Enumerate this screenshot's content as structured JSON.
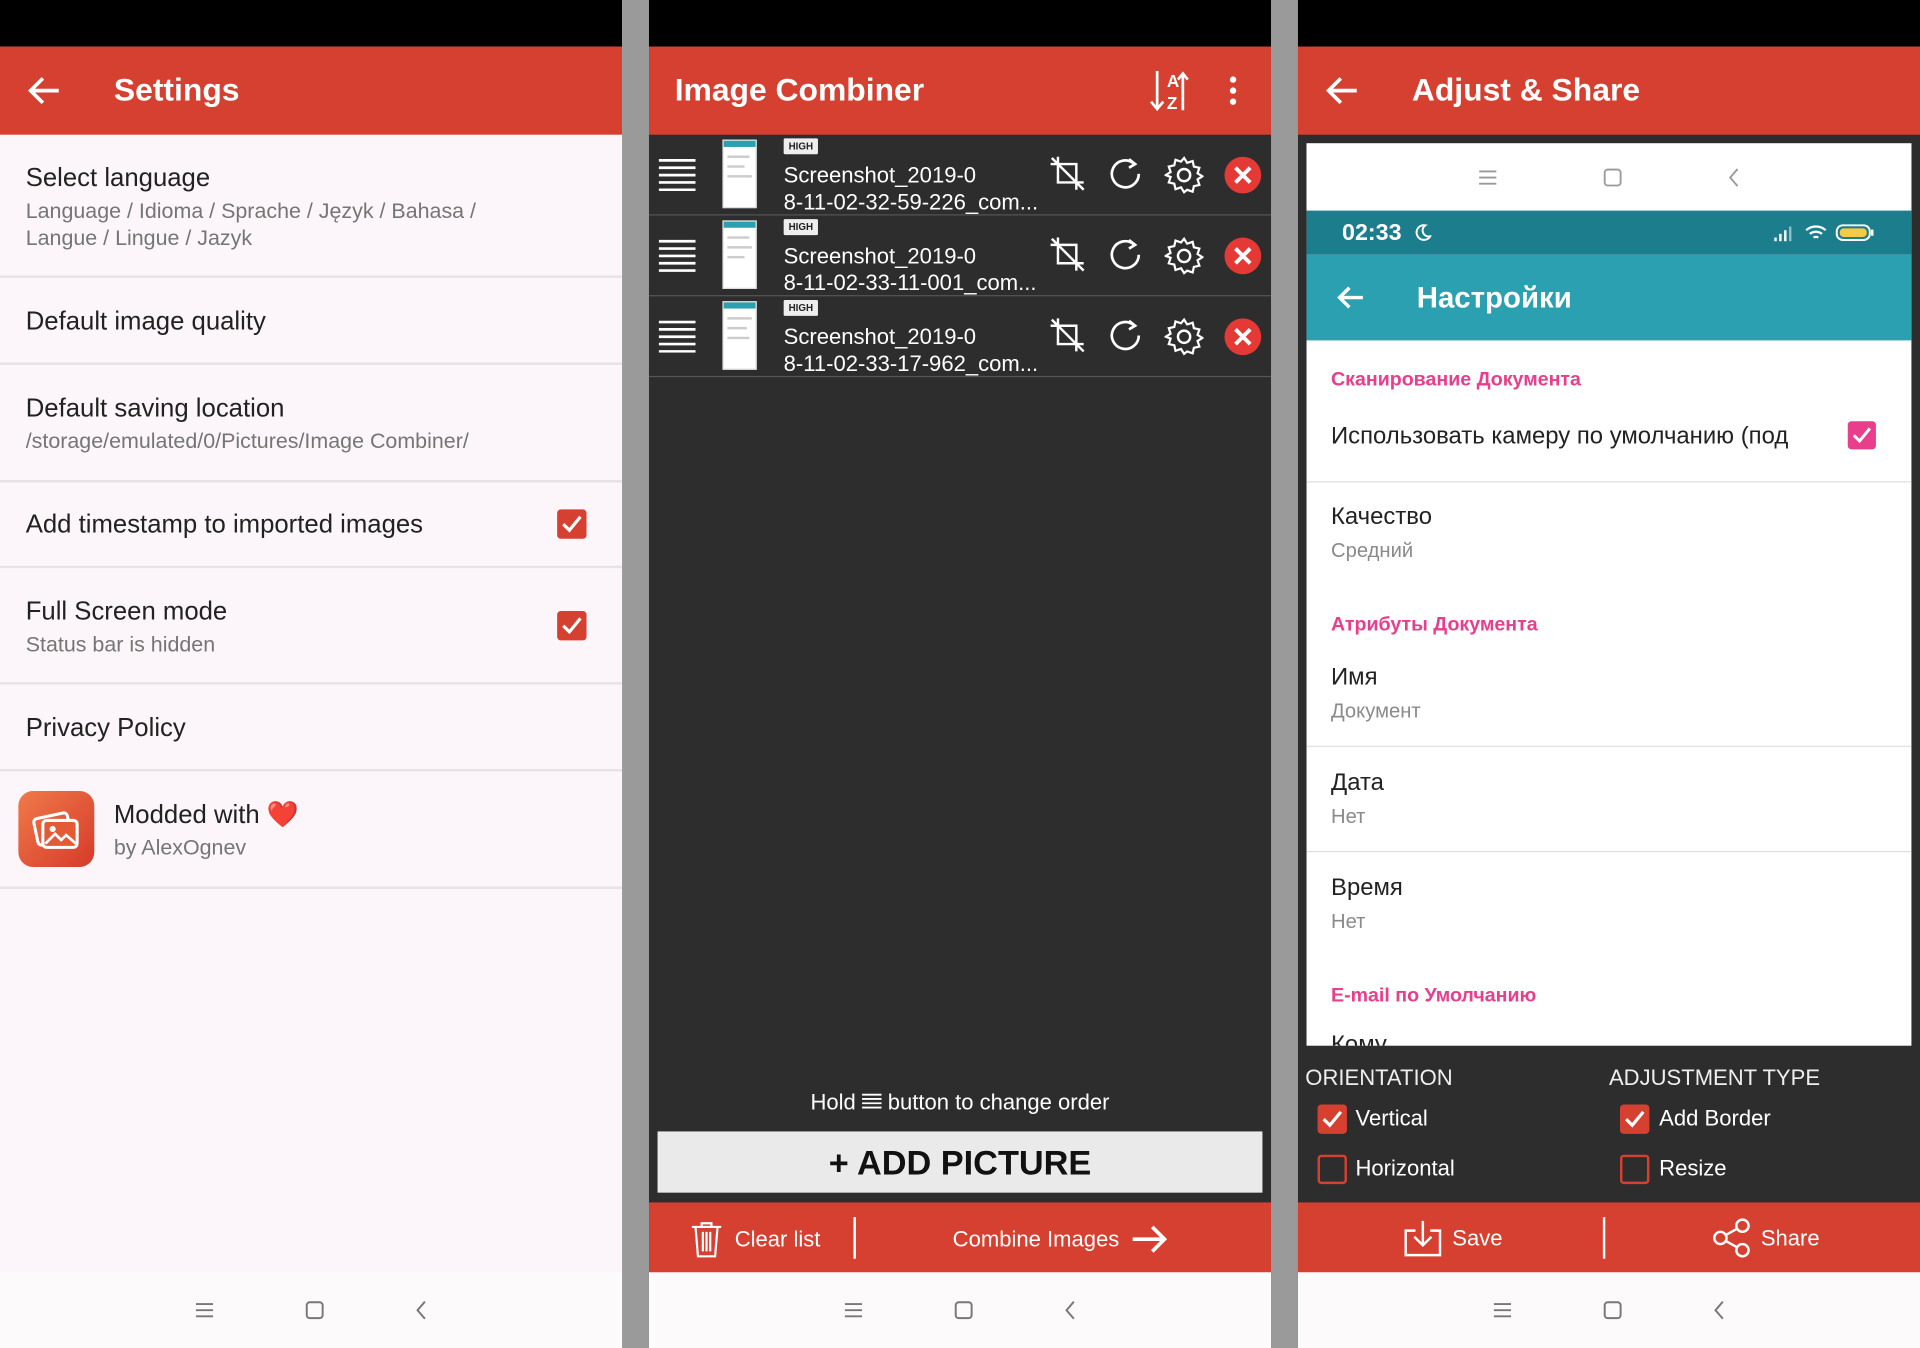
{
  "settings_screen": {
    "title": "Settings",
    "items": [
      {
        "title": "Select language",
        "subtitle": "Language / Idioma / Sprache / Język / Bahasa /\nLangue / Lingue / Jazyk"
      },
      {
        "title": "Default image quality"
      },
      {
        "title": "Default saving location",
        "subtitle": "/storage/emulated/0/Pictures/Image Combiner/"
      },
      {
        "title": "Add timestamp to imported images",
        "checked": true
      },
      {
        "title": "Full Screen mode",
        "subtitle": "Status bar is hidden",
        "checked": true
      },
      {
        "title": "Privacy Policy"
      }
    ],
    "mod": {
      "title": "Modded with ❤️",
      "subtitle": "by AlexOgnev"
    }
  },
  "combiner_screen": {
    "title": "Image Combiner",
    "images": [
      {
        "badge": "HIGH",
        "name": "Screenshot_2019-0\n8-11-02-32-59-226_com..."
      },
      {
        "badge": "HIGH",
        "name": "Screenshot_2019-0\n8-11-02-33-11-001_com..."
      },
      {
        "badge": "HIGH",
        "name": "Screenshot_2019-0\n8-11-02-33-17-962_com..."
      }
    ],
    "hint_prefix": "Hold",
    "hint_suffix": "button to change order",
    "add_button": "+ ADD PICTURE",
    "clear_list": "Clear list",
    "combine": "Combine Images"
  },
  "adjust_screen": {
    "title": "Adjust & Share",
    "preview": {
      "time": "02:33",
      "title": "Настройки",
      "sections": [
        {
          "header": "Сканирование Документа",
          "items": [
            {
              "title": "Использовать камеру по умолчанию (под",
              "checked": true
            },
            {
              "title": "Качество",
              "subtitle": "Средний"
            }
          ]
        },
        {
          "header": "Атрибуты Документа",
          "items": [
            {
              "title": "Имя",
              "subtitle": "Документ"
            },
            {
              "title": "Дата",
              "subtitle": "Нет"
            },
            {
              "title": "Время",
              "subtitle": "Нет"
            }
          ]
        },
        {
          "header": "E-mail по Умолчанию",
          "items": [
            {
              "title": "Кому"
            }
          ]
        }
      ]
    },
    "orientation": {
      "label": "ORIENTATION",
      "options": [
        {
          "label": "Vertical",
          "checked": true
        },
        {
          "label": "Horizontal",
          "checked": false
        }
      ]
    },
    "adjustment": {
      "label": "ADJUSTMENT TYPE",
      "options": [
        {
          "label": "Add Border",
          "checked": true
        },
        {
          "label": "Resize",
          "checked": false
        }
      ]
    },
    "save": "Save",
    "share": "Share"
  },
  "colors": {
    "accent": "#d54030",
    "dark": "#2d2d2d",
    "teal": "#2aa0b0",
    "pink": "#e83e8c"
  }
}
